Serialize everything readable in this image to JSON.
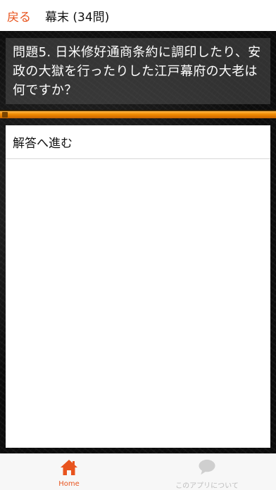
{
  "header": {
    "back_label": "戻る",
    "title": "幕末 (34問)"
  },
  "question": {
    "text": "問題5. 日米修好通商条約に調印したり、安政の大獄を行ったりした江戸幕府の大老は何ですか？"
  },
  "progress": {
    "fraction": 1.0
  },
  "answer": {
    "button_label": "解答へ進む"
  },
  "tabbar": {
    "tabs": [
      {
        "label": "Home",
        "icon": "home-icon",
        "active": true
      },
      {
        "label": "このアプリについて",
        "icon": "chat-bubble-icon",
        "active": false
      }
    ]
  },
  "colors": {
    "accent": "#e8541e",
    "progress": "#f08a00",
    "inactive": "#bdbdbd"
  }
}
